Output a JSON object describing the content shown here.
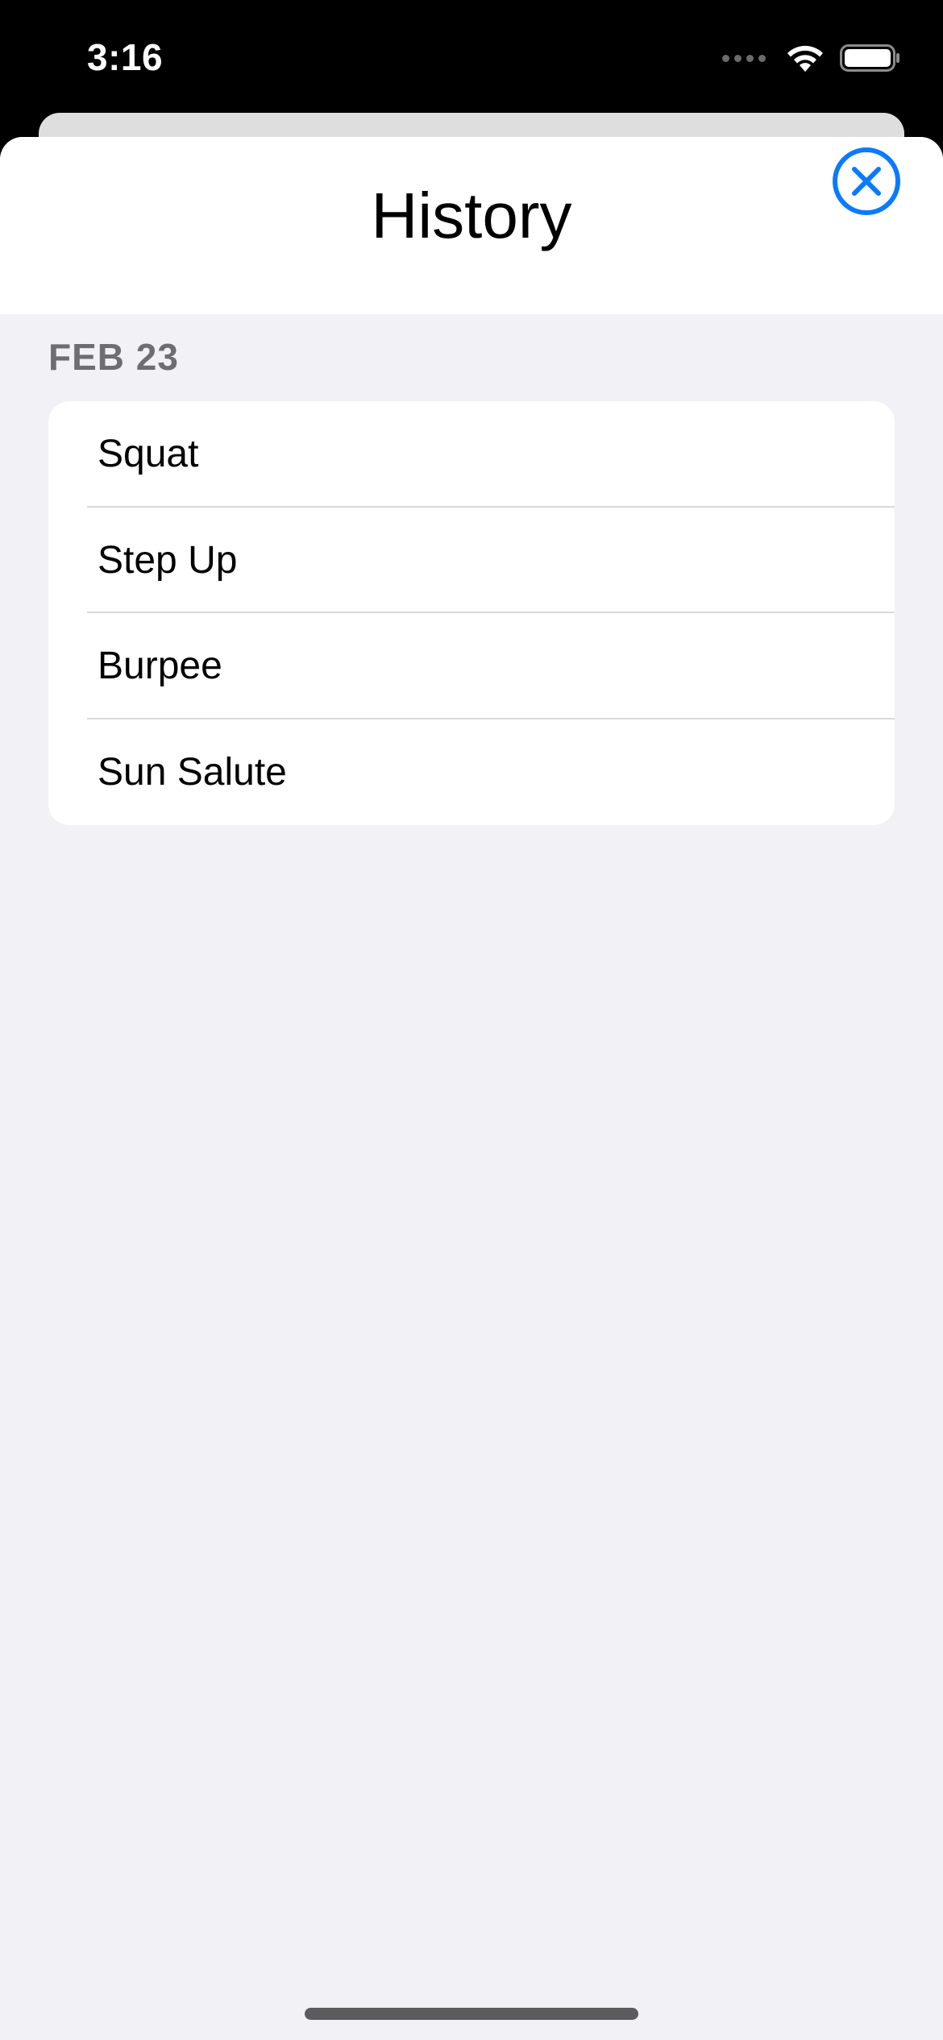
{
  "status_bar": {
    "time": "3:16",
    "icons": [
      "cellular-dots-icon",
      "wifi-icon",
      "battery-icon"
    ]
  },
  "sheet": {
    "title": "History",
    "close_icon": "xmark-circle-icon",
    "accent_color": "#0a7aff"
  },
  "history": {
    "sections": [
      {
        "header": "FEB 23",
        "items": [
          {
            "label": "Squat"
          },
          {
            "label": "Step Up"
          },
          {
            "label": "Burpee"
          },
          {
            "label": "Sun Salute"
          }
        ]
      }
    ]
  }
}
